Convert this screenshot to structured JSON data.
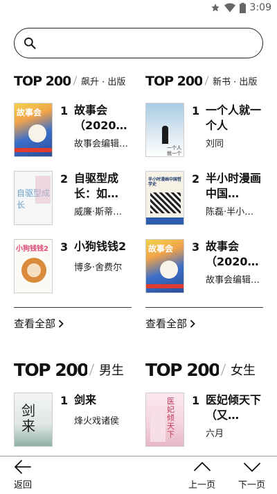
{
  "status": {
    "time": "3:09"
  },
  "search": {
    "placeholder": ""
  },
  "sections": [
    {
      "logo": "TOP 200",
      "subtitle": "飙升 · 出版",
      "books": [
        {
          "rank": "1",
          "title": "故事会（2020…",
          "author": "故事会编辑…"
        },
        {
          "rank": "2",
          "title": "自驱型成长：如…",
          "author": "威廉·斯蒂…"
        },
        {
          "rank": "3",
          "title": "小狗钱钱2",
          "author": "博多·舍费尔"
        }
      ],
      "view_all": "查看全部"
    },
    {
      "logo": "TOP 200",
      "subtitle": "新书 · 出版",
      "books": [
        {
          "rank": "1",
          "title": "一个人就一个人",
          "author": "刘同"
        },
        {
          "rank": "2",
          "title": "半小时漫画中国…",
          "author": "陈磊·半小…"
        },
        {
          "rank": "3",
          "title": "故事会（2020…",
          "author": "故事会编辑…"
        }
      ],
      "view_all": "查看全部"
    },
    {
      "logo": "TOP 200",
      "subtitle": "男生",
      "books": [
        {
          "rank": "1",
          "title": "剑来",
          "author": "烽火戏诸侯"
        }
      ]
    },
    {
      "logo": "TOP 200",
      "subtitle": "女生",
      "books": [
        {
          "rank": "1",
          "title": "医妃倾天下（又…",
          "author": "六月"
        }
      ]
    }
  ],
  "cover_text": {
    "gushihui": "故事会",
    "zhiqu": "自驱型成长",
    "xiaogou": "小狗钱钱2",
    "yigeren": "一个人就一个人",
    "banxiaoshi": "半小时漫画中国哲学史",
    "jianlai": "剑来",
    "yifei": "医妃倾天下"
  },
  "bottom_nav": {
    "back": "返回",
    "prev": "上一页",
    "next": "下一页"
  }
}
